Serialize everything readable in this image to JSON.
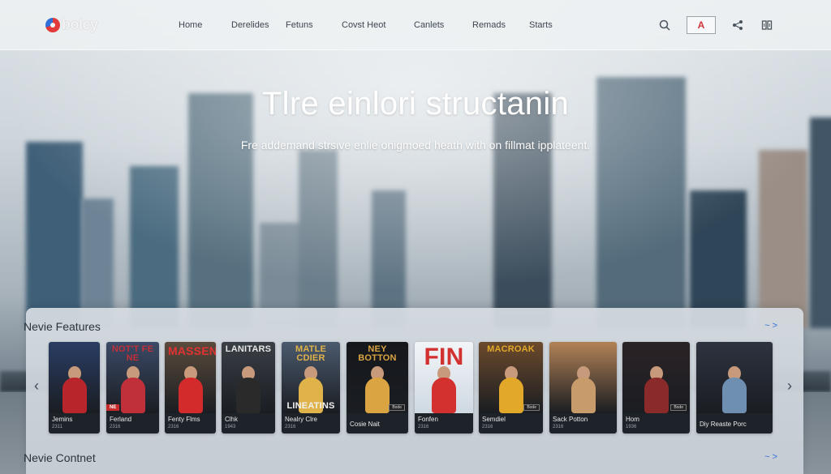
{
  "brand": {
    "name": "bolcy"
  },
  "nav": {
    "links": [
      "Home",
      "Derelides",
      "Fetuns",
      "Covst Heot",
      "Canlets",
      "Remads",
      "Starts"
    ],
    "user_initial": "A"
  },
  "hero": {
    "title": "Tlre einlori structanin",
    "subtitle": "Fre addemand strsive enlie onigmoed heath with on fillmat ipplateent."
  },
  "sections": [
    {
      "title": "Nevie Features",
      "more_label": "~ >"
    },
    {
      "title": "Nevie Contnet",
      "more_label": "~ >"
    }
  ],
  "carousel": {
    "prev_label": "‹",
    "next_label": "›"
  },
  "movies": [
    {
      "poster_title": "",
      "name": "Jemins",
      "year": "2311",
      "accent": "#b8262b",
      "bg": "#2a3d63",
      "top_strip": "red"
    },
    {
      "poster_title": "NOT'T FE NE",
      "name": "Ferland",
      "year": "2316",
      "accent": "#c0303a",
      "bg": "#3b4a66",
      "badge": "NE"
    },
    {
      "poster_title": "MASSEN",
      "name": "Fenty Flms",
      "year": "2316",
      "accent": "#d32b2b",
      "bg": "#5a4b3c",
      "badge": ""
    },
    {
      "poster_title": "LANITARS",
      "name": "Clhk",
      "year": "1943",
      "accent": "#2a2a2a",
      "bg": "#3a3f46"
    },
    {
      "poster_title": "MATLE CDIER",
      "name": "Nealry Clre",
      "year": "2316",
      "accent": "#e0b34a",
      "bg": "#4b5a6e",
      "sub": "LINEATINS"
    },
    {
      "poster_title": "NEY BOTTON",
      "name": "Cosie Nait",
      "year": "",
      "accent": "#d9a441",
      "bg": "#15171b",
      "tag": "Bode"
    },
    {
      "poster_title": "FIN",
      "name": "Fonfen",
      "year": "2316",
      "accent": "#d33030",
      "bg": "#e8eef3"
    },
    {
      "poster_title": "MACROAK",
      "name": "Semdiel",
      "year": "2316",
      "accent": "#e2a82a",
      "bg": "#6b4a2c",
      "tag": "Bode"
    },
    {
      "poster_title": "",
      "name": "Sack Potton",
      "year": "2316",
      "accent": "#c89c6a",
      "bg": "#b28256"
    },
    {
      "poster_title": "",
      "name": "Hom",
      "year": "1936",
      "accent": "#8a2a2a",
      "bg": "#2b2326",
      "tag": "Bode"
    },
    {
      "poster_title": "",
      "name": "Diy Reaste Porc",
      "year": "",
      "accent": "#6f8fb1",
      "bg": "#2e3340"
    }
  ]
}
